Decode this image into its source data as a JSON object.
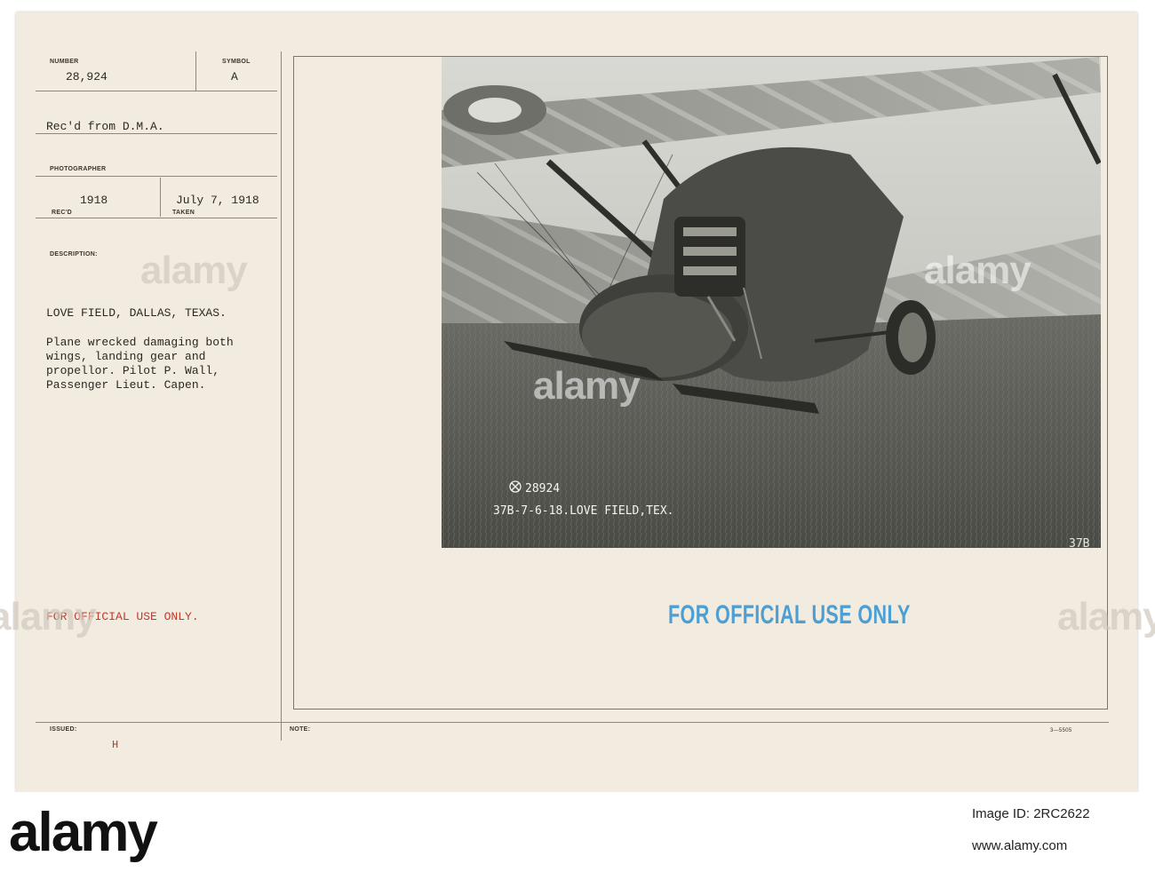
{
  "record": {
    "number_label": "NUMBER",
    "number": "28,924",
    "symbol_label": "SYMBOL",
    "symbol": "A",
    "received_from": "Rec'd from D.M.A.",
    "photographer_label": "PHOTOGRAPHER",
    "recd_year": "1918",
    "recd_label": "REC'D",
    "taken_date": "July 7, 1918",
    "taken_label": "TAKEN",
    "description_label": "DESCRIPTION:",
    "location": "LOVE FIELD, DALLAS, TEXAS.",
    "description_lines": [
      "Plane wrecked damaging both",
      "wings, landing gear and",
      "propellor.   Pilot P. Wall,",
      "Passenger Lieut. Capen."
    ],
    "restriction": "FOR OFFICIAL USE ONLY.",
    "issued_label": "ISSUED:",
    "issued_value": "H",
    "note_label": "NOTE:",
    "form_number": "3—5505"
  },
  "photo": {
    "inscription_number": "28924",
    "inscription_caption": "37B-7-6-18.LOVE FIELD,TEX.",
    "corner_mark": "37B"
  },
  "stamp": {
    "text": "FOR OFFICIAL USE ONLY"
  },
  "watermark": {
    "text": "alamy"
  },
  "footer": {
    "logo": "alamy",
    "stock_id": "Image ID: 2RC2622",
    "site": "www.alamy.com"
  }
}
